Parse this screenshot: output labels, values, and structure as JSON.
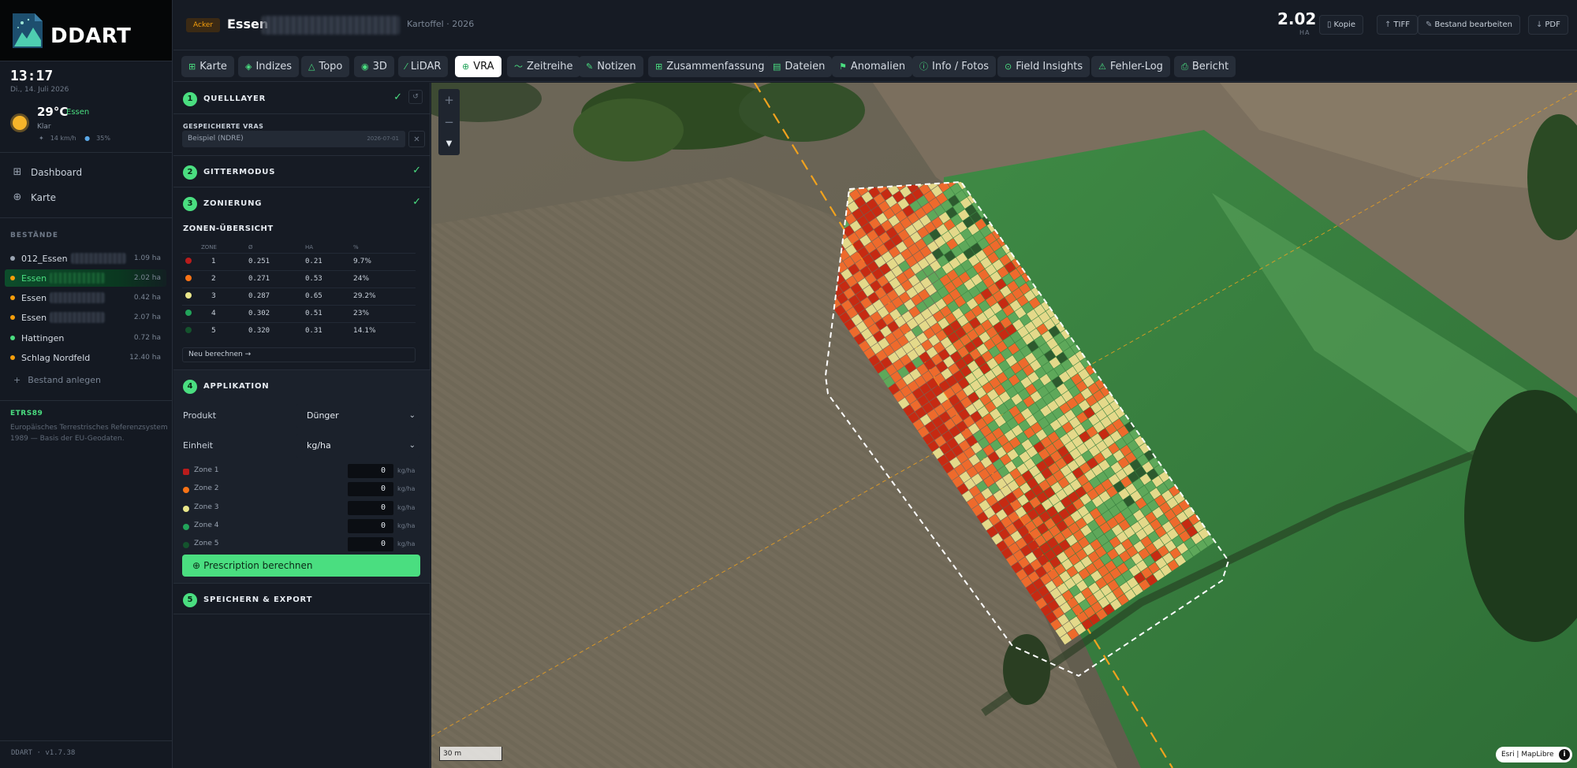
{
  "brand": {
    "name": "DDART"
  },
  "clock": {
    "time": "13:17",
    "date": "Di., 14. Juli 2026"
  },
  "weather": {
    "temp": "29°C",
    "city": "Essen",
    "condition": "Klar",
    "wind": "14 km/h",
    "humidity": "35%"
  },
  "nav": [
    {
      "label": "Dashboard",
      "icon": "grid-icon"
    },
    {
      "label": "Karte",
      "icon": "globe-icon"
    }
  ],
  "fields_section": "BESTÄNDE",
  "fields": [
    {
      "name": "012_Essen",
      "size": "1.09 ha",
      "color": "#9aa4b2"
    },
    {
      "name": "Essen",
      "size": "2.02 ha",
      "color": "#f59e0b"
    },
    {
      "name": "Essen",
      "size": "0.42 ha",
      "color": "#f59e0b"
    },
    {
      "name": "Essen",
      "size": "2.07 ha",
      "color": "#f59e0b"
    },
    {
      "name": "Hattingen",
      "size": "0.72 ha",
      "color": "#4ade80"
    },
    {
      "name": "Schlag Nordfeld",
      "size": "12.40 ha",
      "color": "#f59e0b"
    }
  ],
  "add_field": "Bestand anlegen",
  "crs": {
    "title": "ETRS89",
    "desc": "Europäisches Terrestrisches Referenzsystem 1989 — Basis der EU-Geodaten."
  },
  "version": "DDART · v1.7.38",
  "header": {
    "badge": "Acker",
    "title": "Essen",
    "crop": "Kartoffel · 2026",
    "area_value": "2.02",
    "area_unit": "HA",
    "buttons": {
      "copy": "Kopie",
      "tiff": "TIFF",
      "edit": "Bestand bearbeiten",
      "pdf": "PDF"
    }
  },
  "tabs": [
    {
      "label": "Karte",
      "glyph": "⊞"
    },
    {
      "label": "Indizes",
      "glyph": "◈"
    },
    {
      "label": "Topo",
      "glyph": "△"
    },
    {
      "label": "3D",
      "glyph": "◉"
    },
    {
      "label": "LiDAR",
      "glyph": "⁄"
    },
    {
      "label": "VRA",
      "glyph": "⊕"
    },
    {
      "label": "Zeitreihe",
      "glyph": "〜"
    },
    {
      "label": "Notizen",
      "glyph": "✎"
    },
    {
      "label": "Zusammenfassung",
      "glyph": "⊞"
    },
    {
      "label": "Dateien",
      "glyph": "▤"
    },
    {
      "label": "Anomalien",
      "glyph": "⚑"
    },
    {
      "label": "Info / Fotos",
      "glyph": "ⓘ"
    },
    {
      "label": "Field Insights",
      "glyph": "⊙"
    },
    {
      "label": "Fehler-Log",
      "glyph": "⚠"
    },
    {
      "label": "Bericht",
      "glyph": "⎙"
    }
  ],
  "active_tab": "VRA",
  "panel": {
    "step1": {
      "num": "1",
      "title": "QUELLLAYER"
    },
    "saved_label": "GESPEICHERTE VRAS",
    "saved_item": {
      "name": "Beispiel (NDRE)",
      "date": "2026-07-01"
    },
    "step2": {
      "num": "2",
      "title": "GITTERMODUS"
    },
    "step3": {
      "num": "3",
      "title": "ZONIERUNG"
    },
    "zone_overview_title": "ZONEN-ÜBERSICHT",
    "zone_columns": {
      "zone": "ZONE",
      "mean": "Ø",
      "ha": "HA",
      "pct": "%"
    },
    "zones": [
      {
        "zone": "1",
        "mean": "0.251",
        "ha": "0.21",
        "pct": "9.7%",
        "color": "#b91c1c"
      },
      {
        "zone": "2",
        "mean": "0.271",
        "ha": "0.53",
        "pct": "24%",
        "color": "#f97316"
      },
      {
        "zone": "3",
        "mean": "0.287",
        "ha": "0.65",
        "pct": "29.2%",
        "color": "#e9e68a"
      },
      {
        "zone": "4",
        "mean": "0.302",
        "ha": "0.51",
        "pct": "23%",
        "color": "#22a35a"
      },
      {
        "zone": "5",
        "mean": "0.320",
        "ha": "0.31",
        "pct": "14.1%",
        "color": "#14532d"
      }
    ],
    "recalc": "Neu berechnen →",
    "step4": {
      "num": "4",
      "title": "APPLIKATION"
    },
    "product_label": "Produkt",
    "product_value": "Dünger",
    "unit_label": "Einheit",
    "unit_value": "kg/ha",
    "rates": [
      {
        "label": "Zone 1",
        "value": "0",
        "unit": "kg/ha",
        "color": "#b91c1c"
      },
      {
        "label": "Zone 2",
        "value": "0",
        "unit": "kg/ha",
        "color": "#f97316"
      },
      {
        "label": "Zone 3",
        "value": "0",
        "unit": "kg/ha",
        "color": "#e9e68a"
      },
      {
        "label": "Zone 4",
        "value": "0",
        "unit": "kg/ha",
        "color": "#22a35a"
      },
      {
        "label": "Zone 5",
        "value": "0",
        "unit": "kg/ha",
        "color": "#14532d"
      }
    ],
    "prescribe_button": "Prescription berechnen",
    "step5": {
      "num": "5",
      "title": "SPEICHERN & EXPORT"
    }
  },
  "map": {
    "scale": "30 m",
    "attribution": "Esri | MapLibre",
    "zone_colors": [
      "#c62a12",
      "#ee6a2c",
      "#e4d98a",
      "#5ea85a",
      "#2d5a2e"
    ]
  }
}
